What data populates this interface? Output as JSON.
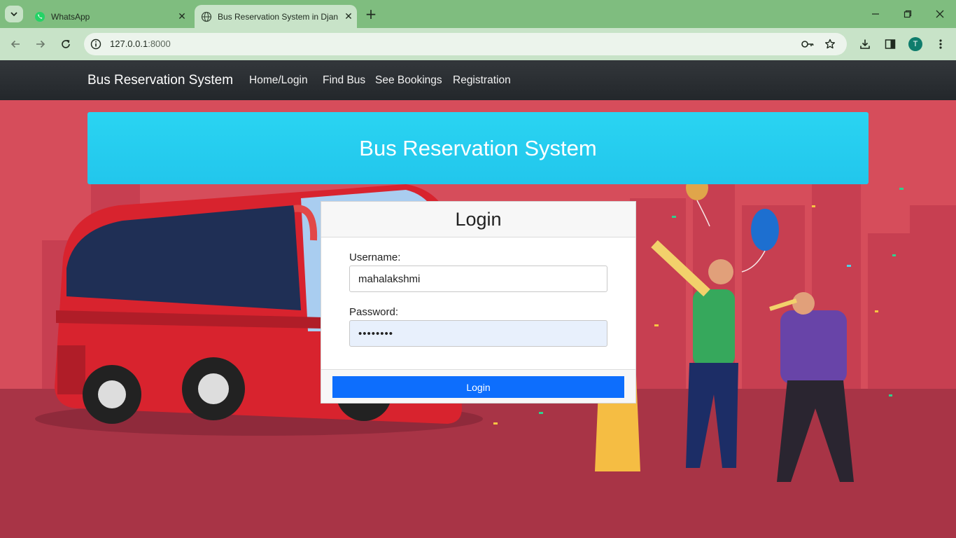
{
  "browser": {
    "tabs": [
      {
        "title": "WhatsApp",
        "active": false,
        "favicon": "whatsapp-icon"
      },
      {
        "title": "Bus Reservation System in Djan",
        "active": true,
        "favicon": "globe-icon"
      }
    ],
    "address": {
      "host": "127.0.0.1",
      "port": ":8000"
    },
    "profile_initial": "T",
    "theme_color": "#7fbd7f"
  },
  "navbar": {
    "brand": "Bus Reservation System",
    "links": [
      "Home/Login",
      "Find Bus",
      "See Bookings",
      "Registration"
    ]
  },
  "banner": {
    "title": "Bus Reservation System"
  },
  "login": {
    "title": "Login",
    "username_label": "Username:",
    "username_value": "mahalakshmi",
    "password_label": "Password:",
    "password_mask": "••••••••",
    "button_label": "Login",
    "button_color": "#0d6efd"
  },
  "colors": {
    "banner": "#22c6ec",
    "background": "#d64d5b",
    "navbar": "#2b2f33"
  }
}
